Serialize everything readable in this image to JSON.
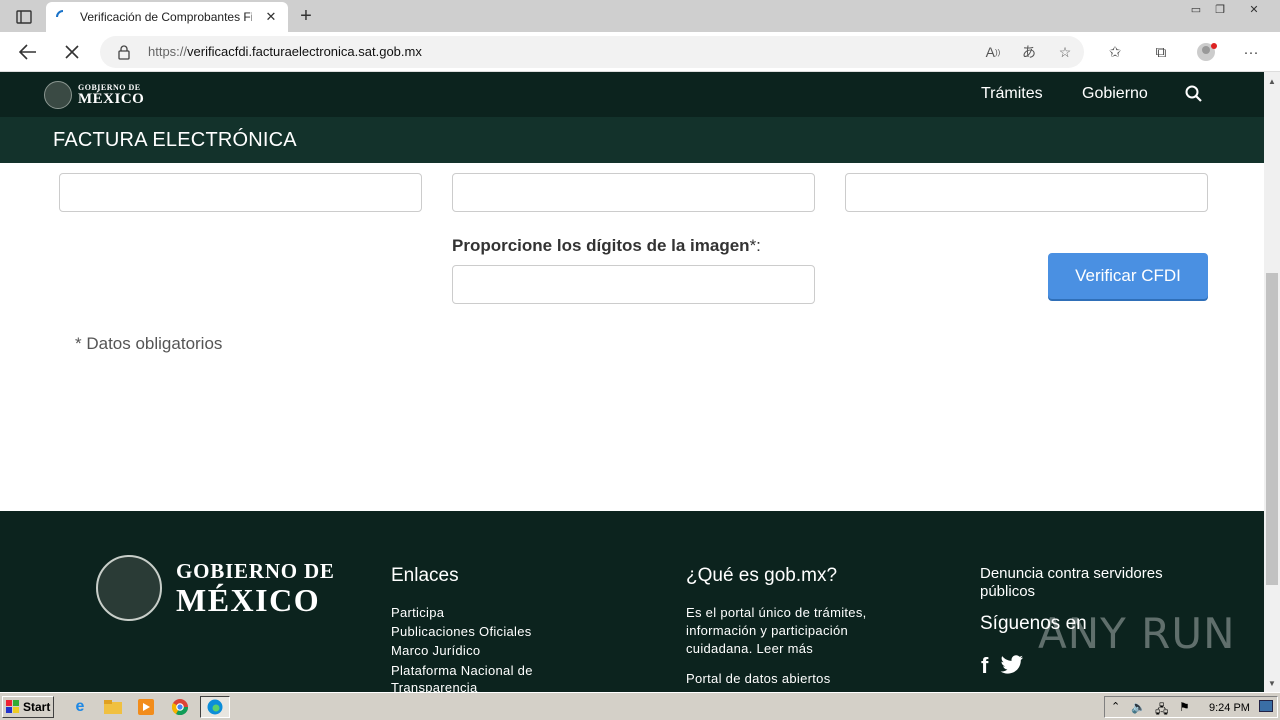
{
  "browser": {
    "tab_title": "Verificación de Comprobantes Fi",
    "url_prefix": "https://",
    "url_host": "verificacfdi.facturaelectronica.sat.gob.mx"
  },
  "gob_header": {
    "logo_line1": "GOBIERNO DE",
    "logo_line2": "MÉXICO",
    "nav": [
      "Trámites",
      "Gobierno"
    ]
  },
  "section_title": "FACTURA ELECTRÓNICA",
  "form": {
    "captcha_label": "Proporcione los dígitos de la imagen",
    "captcha_required": "*:",
    "submit_label": "Verificar CFDI",
    "required_note": "* Datos obligatorios"
  },
  "footer": {
    "logo_line1": "GOBIERNO DE",
    "logo_line2": "MÉXICO",
    "links_title": "Enlaces",
    "links": [
      "Participa",
      "Publicaciones Oficiales",
      "Marco Jurídico",
      "Plataforma Nacional de Transparencia"
    ],
    "about_title": "¿Qué es gob.mx?",
    "about_text": "Es el portal único de trámites, información y participación cuidadana. Leer más",
    "open_data": "Portal de datos abiertos",
    "denuncia": "Denuncia contra servidores públicos",
    "follow": "Síguenos en",
    "watermark": "ANY RUN"
  },
  "taskbar": {
    "start": "Start",
    "clock": "9:24 PM"
  },
  "colors": {
    "gob_dark": "#0c231e",
    "gob_subheader": "#13322b",
    "button_blue": "#4a90e2"
  }
}
